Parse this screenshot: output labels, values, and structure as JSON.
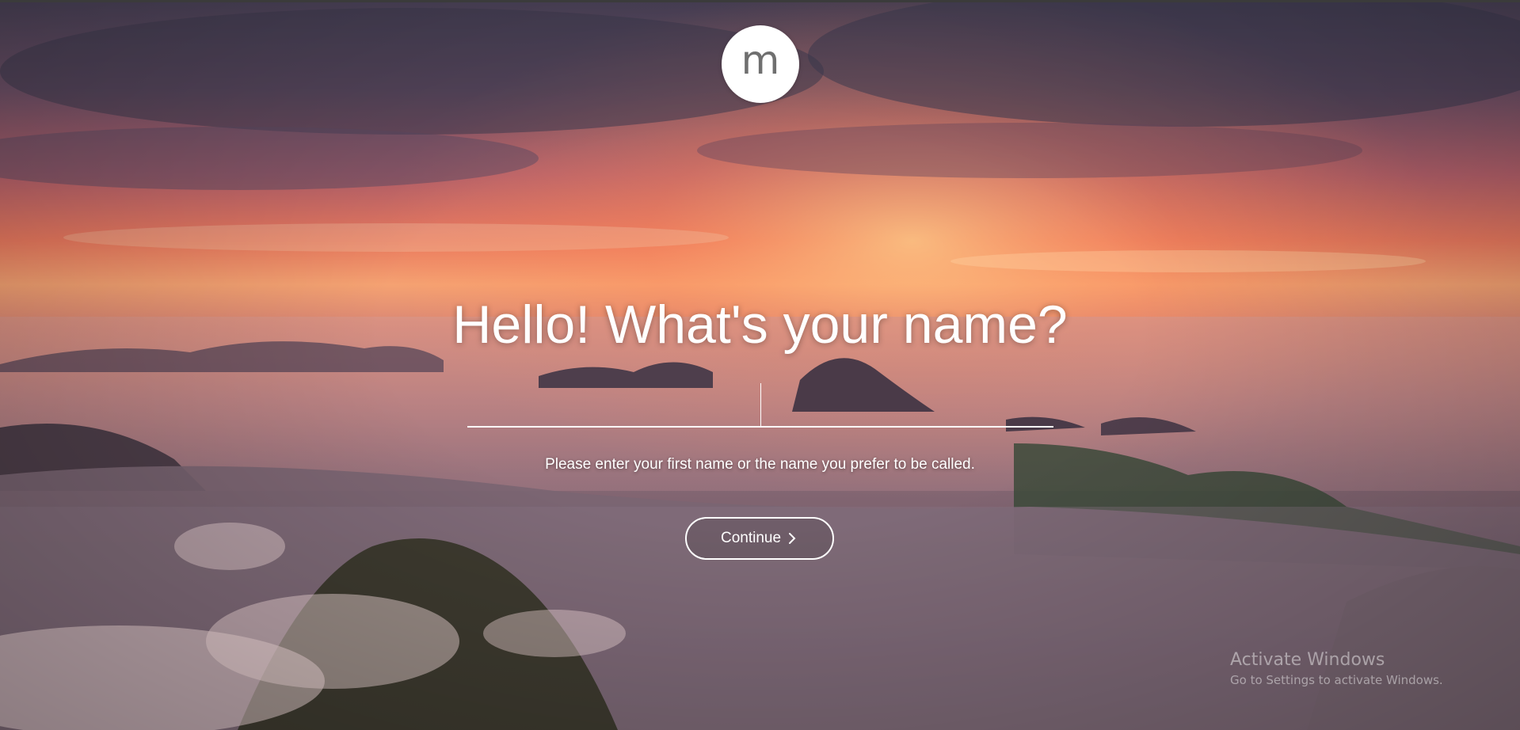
{
  "logo": {
    "letter": "m",
    "icon": "momentum-logo"
  },
  "greeting": {
    "heading": "Hello! What's your name?",
    "input_value": "",
    "hint": "Please enter your first name or the name you prefer to be called."
  },
  "actions": {
    "continue_label": "Continue",
    "continue_icon": "chevron-right-icon"
  },
  "watermark": {
    "title": "Activate Windows",
    "subtitle": "Go to Settings to activate Windows."
  },
  "colors": {
    "text": "#ffffff",
    "logo_bg": "#ffffff",
    "logo_text": "#6f6f6f",
    "sky_top": "#4a4258",
    "sky_glow": "#ef8058",
    "city": "#6f5a68"
  }
}
